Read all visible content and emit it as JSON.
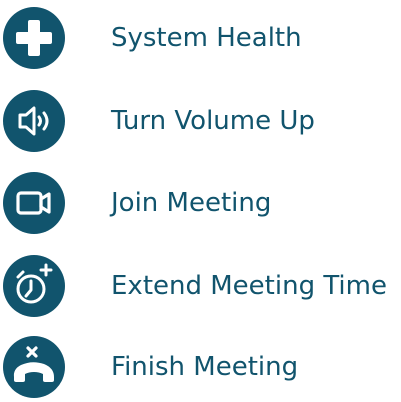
{
  "colors": {
    "accent": "#11546d",
    "icon_glyph": "#ffffff",
    "background": "#ffffff"
  },
  "menu": {
    "items": [
      {
        "label": "System Health",
        "icon": "plus-icon"
      },
      {
        "label": "Turn Volume Up",
        "icon": "speaker-volume-icon"
      },
      {
        "label": "Join Meeting",
        "icon": "video-camera-icon"
      },
      {
        "label": "Extend Meeting Time",
        "icon": "alarm-clock-plus-icon"
      },
      {
        "label": "Finish Meeting",
        "icon": "hang-up-phone-icon"
      }
    ]
  }
}
